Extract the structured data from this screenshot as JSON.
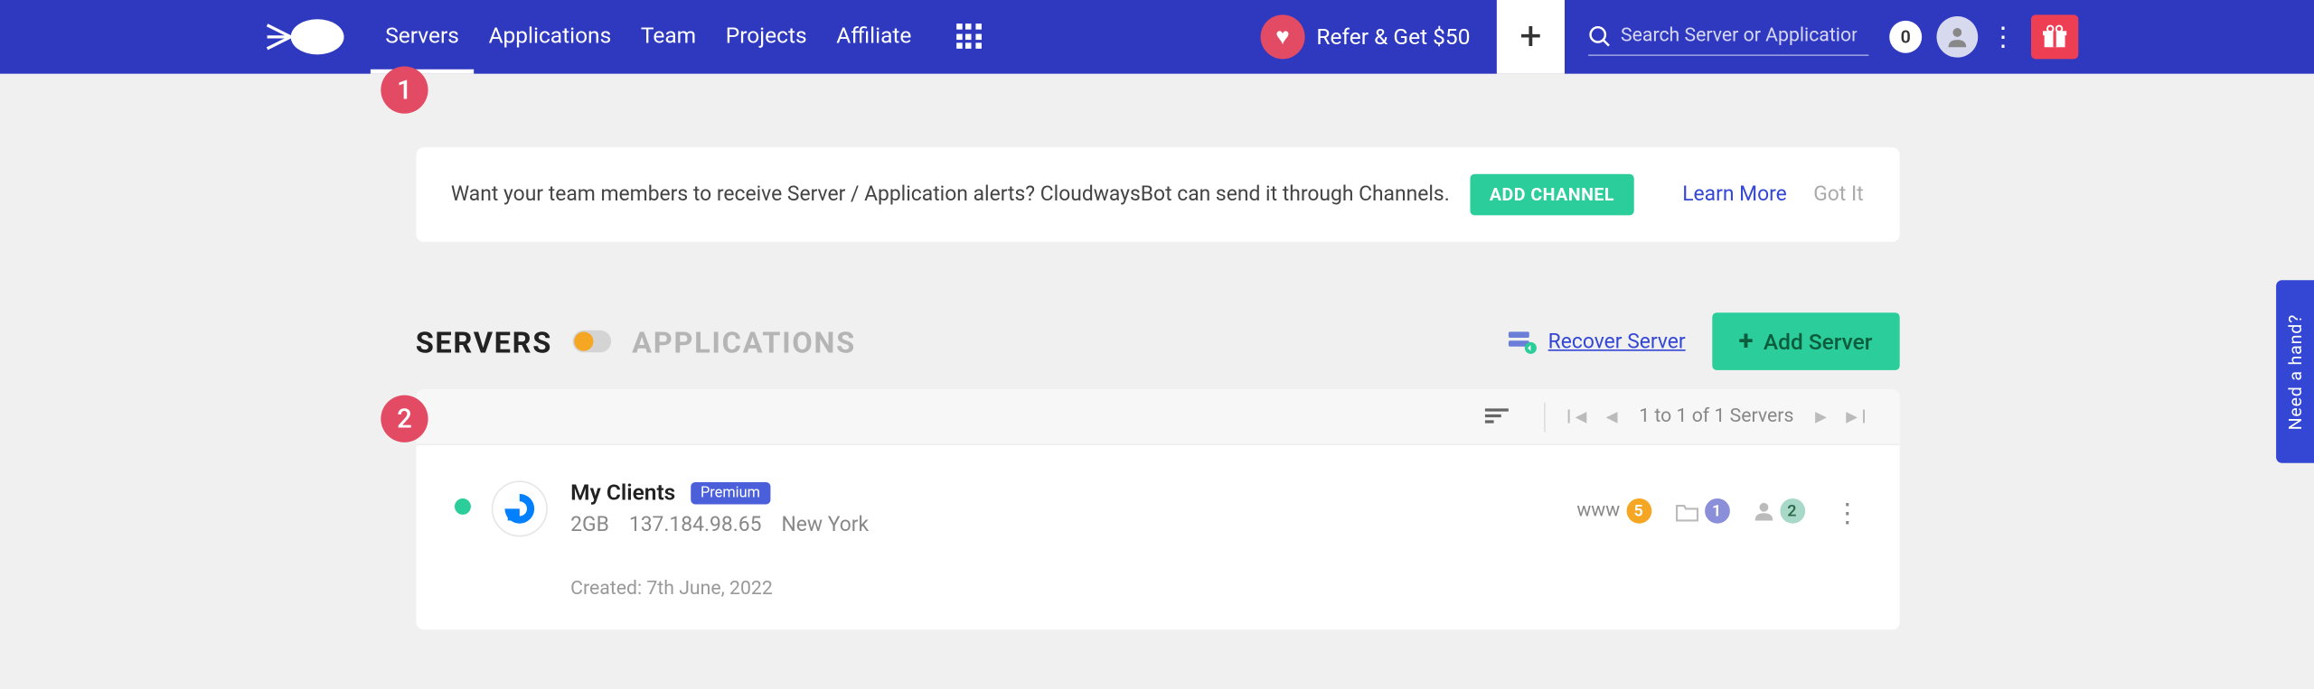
{
  "nav": {
    "links": [
      "Servers",
      "Applications",
      "Team",
      "Projects",
      "Affiliate"
    ],
    "refer": "Refer & Get $50",
    "search_placeholder": "Search Server or Application",
    "notif_count": "0"
  },
  "annotations": {
    "a1": "1",
    "a2": "2"
  },
  "banner": {
    "text": "Want your team members to receive Server / Application alerts? CloudwaysBot can send it through Channels.",
    "add_channel": "ADD CHANNEL",
    "learn_more": "Learn More",
    "got_it": "Got It"
  },
  "tabs": {
    "servers": "SERVERS",
    "applications": "APPLICATIONS",
    "recover": "Recover Server",
    "add_server": "Add Server"
  },
  "pager": {
    "text": "1 to 1 of 1 Servers"
  },
  "server": {
    "name": "My Clients",
    "premium_label": "Premium",
    "size": "2GB",
    "ip": "137.184.98.65",
    "location": "New York",
    "created": "Created: 7th June, 2022",
    "www_label": "www",
    "apps_count": "5",
    "projects_count": "1",
    "members_count": "2"
  },
  "help": "Need a hand?"
}
